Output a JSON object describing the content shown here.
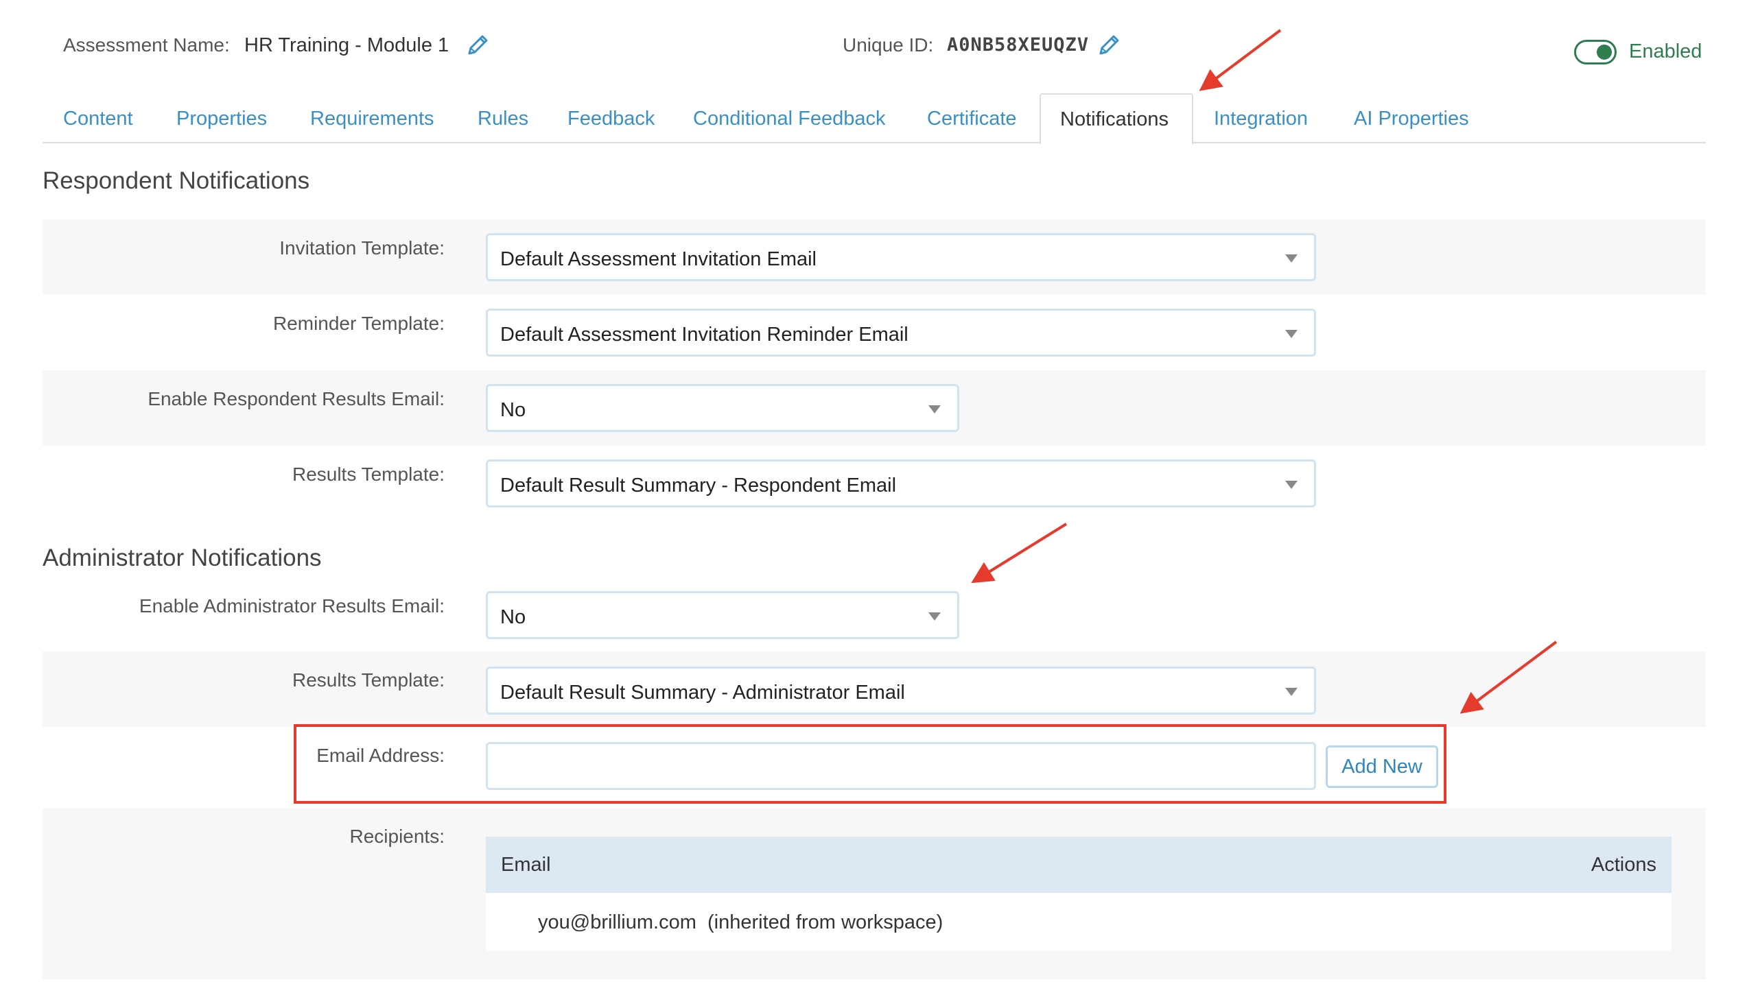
{
  "header": {
    "assessment_name_label": "Assessment Name:",
    "assessment_name_value": "HR Training - Module 1",
    "unique_id_label": "Unique ID:",
    "unique_id_value": "A0NB58XEUQZV",
    "enabled_label": "Enabled",
    "enabled_state": true,
    "accent_color": "#2e7d4f"
  },
  "tabs": [
    {
      "label": "Content",
      "active": false
    },
    {
      "label": "Properties",
      "active": false
    },
    {
      "label": "Requirements",
      "active": false
    },
    {
      "label": "Rules",
      "active": false
    },
    {
      "label": "Feedback",
      "active": false
    },
    {
      "label": "Conditional Feedback",
      "active": false
    },
    {
      "label": "Certificate",
      "active": false
    },
    {
      "label": "Notifications",
      "active": true
    },
    {
      "label": "Integration",
      "active": false
    },
    {
      "label": "AI Properties",
      "active": false
    }
  ],
  "respondent": {
    "title": "Respondent Notifications",
    "invitation_label": "Invitation Template:",
    "invitation_value": "Default Assessment Invitation Email",
    "reminder_label": "Reminder Template:",
    "reminder_value": "Default Assessment Invitation Reminder Email",
    "enable_results_label": "Enable Respondent Results Email:",
    "enable_results_value": "No",
    "results_template_label": "Results Template:",
    "results_template_value": "Default Result Summary - Respondent Email"
  },
  "administrator": {
    "title": "Administrator Notifications",
    "enable_results_label": "Enable Administrator Results Email:",
    "enable_results_value": "No",
    "results_template_label": "Results Template:",
    "results_template_value": "Default Result Summary - Administrator Email",
    "email_address_label": "Email Address:",
    "email_address_value": "",
    "add_new_label": "Add New",
    "recipients_label": "Recipients:",
    "recipients_columns": {
      "email": "Email",
      "actions": "Actions"
    },
    "recipients": [
      {
        "email": "you@brillium.com  (inherited from workspace)"
      }
    ]
  },
  "annotation_color": "#e53b2c",
  "icons": {
    "edit": "pencil-icon",
    "dropdown": "caret-down-icon",
    "toggle": "toggle-switch-icon"
  }
}
